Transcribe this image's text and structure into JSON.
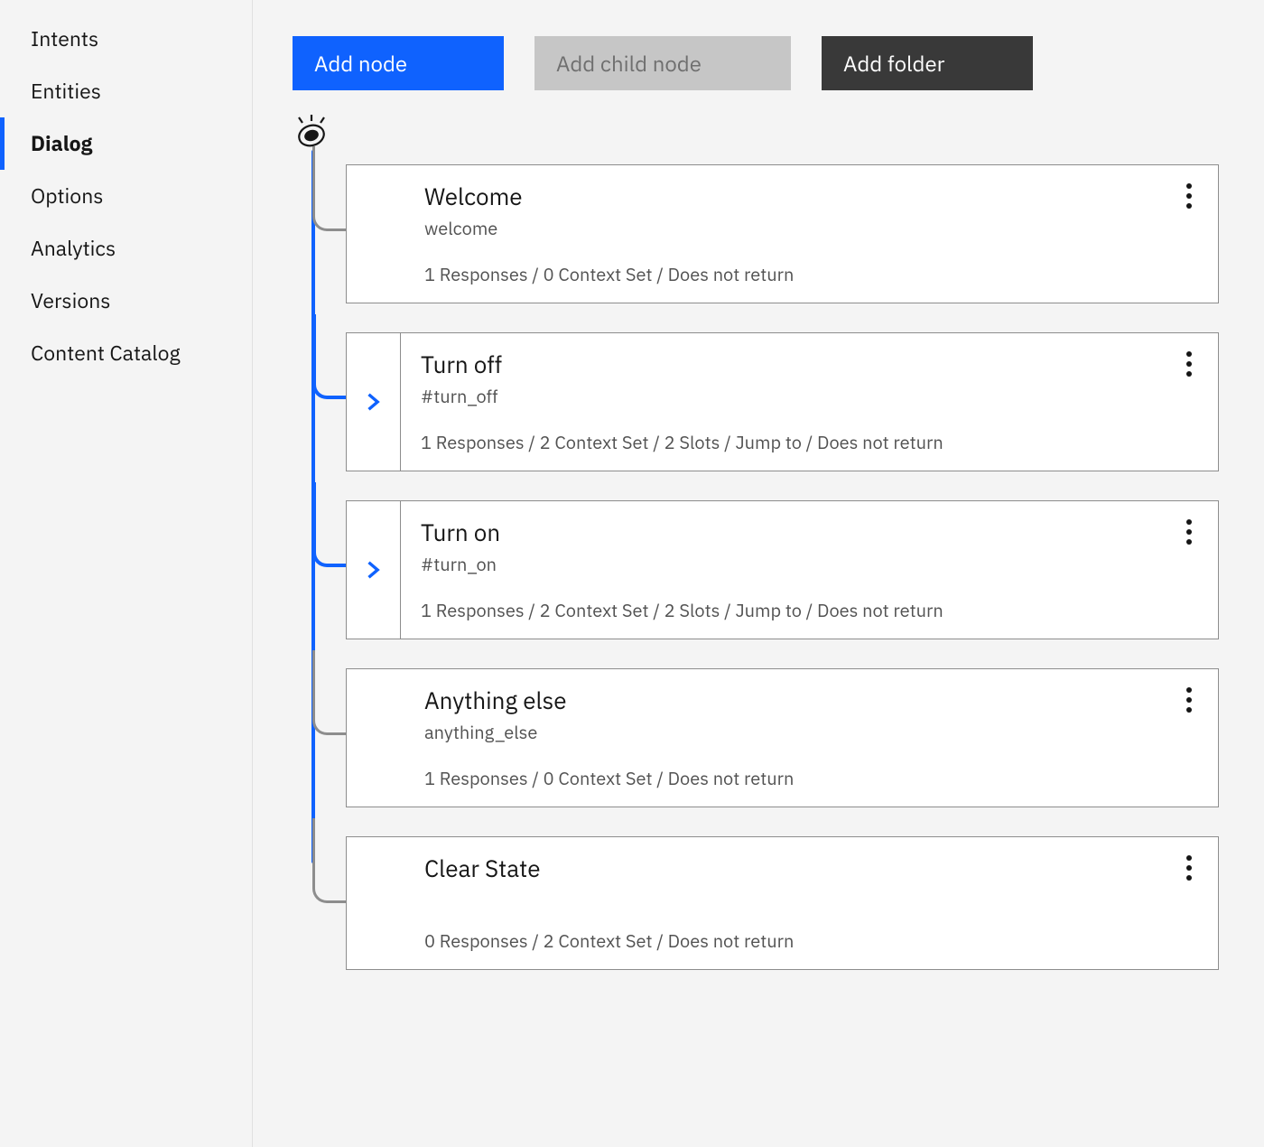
{
  "sidebar": {
    "items": [
      {
        "label": "Intents",
        "active": false
      },
      {
        "label": "Entities",
        "active": false
      },
      {
        "label": "Dialog",
        "active": true
      },
      {
        "label": "Options",
        "active": false
      },
      {
        "label": "Analytics",
        "active": false
      },
      {
        "label": "Versions",
        "active": false
      },
      {
        "label": "Content Catalog",
        "active": false
      }
    ]
  },
  "toolbar": {
    "add_node": "Add node",
    "add_child_node": "Add child node",
    "add_folder": "Add folder"
  },
  "nodes": [
    {
      "title": "Welcome",
      "condition": "welcome",
      "summary": "1 Responses / 0 Context Set / Does not return",
      "expandable": false,
      "connector": "gray"
    },
    {
      "title": "Turn off",
      "condition": "#turn_off",
      "summary": "1 Responses / 2 Context Set / 2 Slots / Jump to / Does not return",
      "expandable": true,
      "connector": "blue"
    },
    {
      "title": "Turn on",
      "condition": "#turn_on",
      "summary": "1 Responses / 2 Context Set / 2 Slots / Jump to / Does not return",
      "expandable": true,
      "connector": "blue"
    },
    {
      "title": "Anything else",
      "condition": "anything_else",
      "summary": "1 Responses / 0 Context Set / Does not return",
      "expandable": false,
      "connector": "gray"
    },
    {
      "title": "Clear State",
      "condition": "",
      "summary": "0 Responses / 2 Context Set / Does not return",
      "expandable": false,
      "connector": "gray"
    }
  ]
}
